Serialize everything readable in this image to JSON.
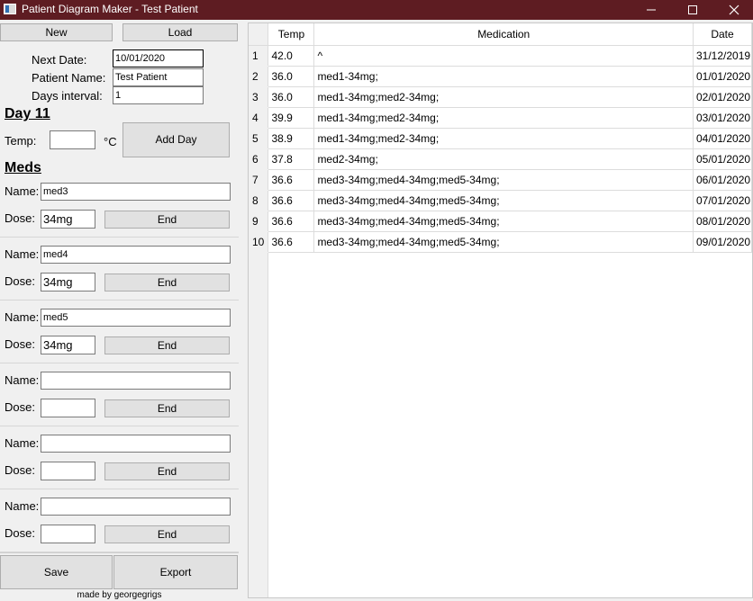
{
  "window": {
    "title": "Patient Diagram Maker - Test Patient",
    "icon": "app-icon",
    "colors": {
      "titlebar": "#5e1c22"
    }
  },
  "toolbar": {
    "new_label": "New",
    "load_label": "Load"
  },
  "form": {
    "next_date_label": "Next Date:",
    "next_date_value": "10/01/2020",
    "patient_name_label": "Patient Name:",
    "patient_name_value": "Test Patient",
    "days_interval_label": "Days interval:",
    "days_interval_value": "1"
  },
  "day": {
    "heading": "Day 11",
    "temp_label": "Temp:",
    "temp_value": "",
    "temp_unit": "°C",
    "add_day_label": "Add Day"
  },
  "meds": {
    "heading": "Meds",
    "name_label": "Name:",
    "dose_label": "Dose:",
    "end_label": "End",
    "items": [
      {
        "name": "med3",
        "dose": "34mg"
      },
      {
        "name": "med4",
        "dose": "34mg"
      },
      {
        "name": "med5",
        "dose": "34mg"
      },
      {
        "name": "",
        "dose": ""
      },
      {
        "name": "",
        "dose": ""
      },
      {
        "name": "",
        "dose": ""
      }
    ]
  },
  "bottom": {
    "save_label": "Save",
    "export_label": "Export",
    "credit": "made by georgegrigs"
  },
  "table": {
    "columns": [
      "Temp",
      "Medication",
      "Date"
    ],
    "rows": [
      {
        "num": "1",
        "temp": "42.0",
        "medication": "^",
        "date": "31/12/2019"
      },
      {
        "num": "2",
        "temp": "36.0",
        "medication": "med1-34mg;",
        "date": "01/01/2020"
      },
      {
        "num": "3",
        "temp": "36.0",
        "medication": "med1-34mg;med2-34mg;",
        "date": "02/01/2020"
      },
      {
        "num": "4",
        "temp": "39.9",
        "medication": "med1-34mg;med2-34mg;",
        "date": "03/01/2020"
      },
      {
        "num": "5",
        "temp": "38.9",
        "medication": "med1-34mg;med2-34mg;",
        "date": "04/01/2020"
      },
      {
        "num": "6",
        "temp": "37.8",
        "medication": "med2-34mg;",
        "date": "05/01/2020"
      },
      {
        "num": "7",
        "temp": "36.6",
        "medication": "med3-34mg;med4-34mg;med5-34mg;",
        "date": "06/01/2020"
      },
      {
        "num": "8",
        "temp": "36.6",
        "medication": "med3-34mg;med4-34mg;med5-34mg;",
        "date": "07/01/2020"
      },
      {
        "num": "9",
        "temp": "36.6",
        "medication": "med3-34mg;med4-34mg;med5-34mg;",
        "date": "08/01/2020"
      },
      {
        "num": "10",
        "temp": "36.6",
        "medication": "med3-34mg;med4-34mg;med5-34mg;",
        "date": "09/01/2020"
      }
    ]
  }
}
